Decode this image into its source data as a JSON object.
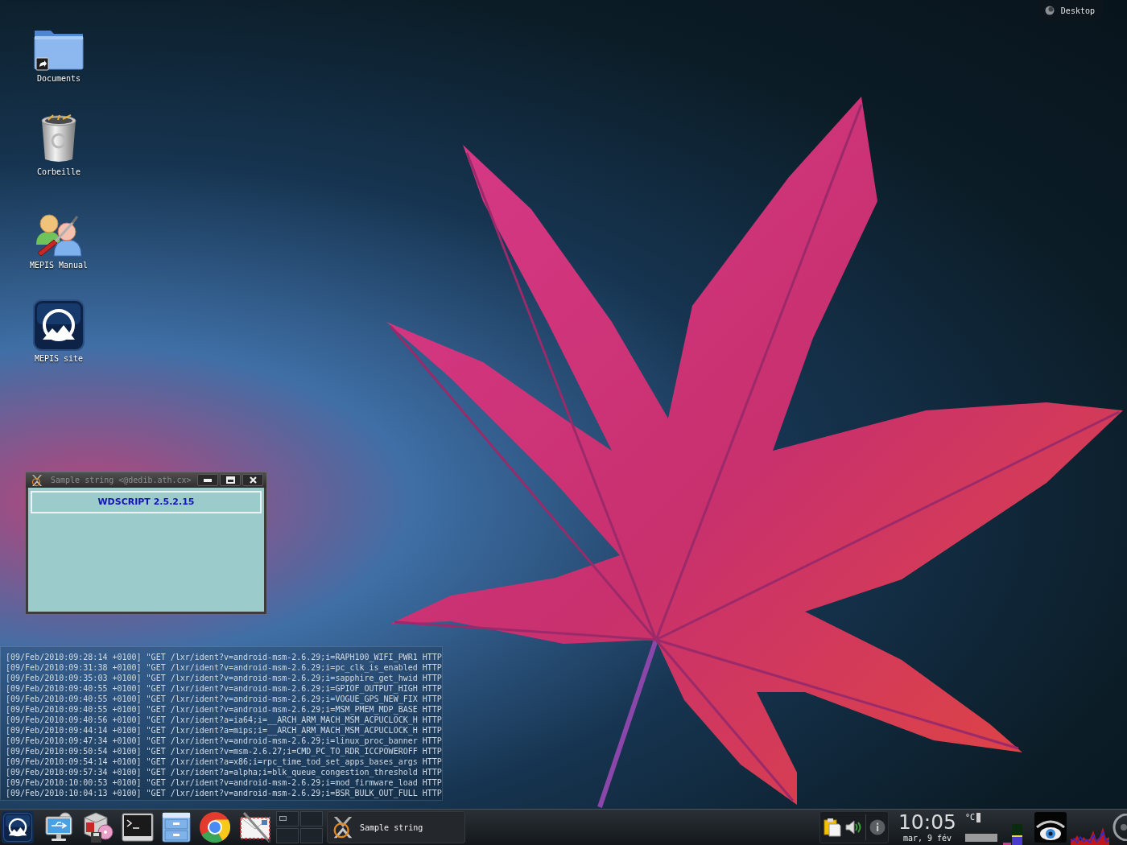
{
  "toolbox": {
    "label": "Desktop"
  },
  "desktop_icons": [
    {
      "label": "Documents"
    },
    {
      "label": "Corbeille"
    },
    {
      "label": "MEPIS Manual"
    },
    {
      "label": "MEPIS site"
    }
  ],
  "window": {
    "title": "Sample string <@dedib.ath.cx>",
    "heading": "WDSCRIPT 2.5.2.15"
  },
  "log_lines": [
    "[09/Feb/2010:09:28:14 +0100] \"GET /lxr/ident?v=android-msm-2.6.29;i=RAPH100_WIFI_PWR1 HTTP",
    "[09/Feb/2010:09:31:38 +0100] \"GET /lxr/ident?v=android-msm-2.6.29;i=pc_clk_is_enabled HTTP",
    "[09/Feb/2010:09:35:03 +0100] \"GET /lxr/ident?v=android-msm-2.6.29;i=sapphire_get_hwid HTTP",
    "[09/Feb/2010:09:40:55 +0100] \"GET /lxr/ident?v=android-msm-2.6.29;i=GPIOF_OUTPUT_HIGH HTTP",
    "[09/Feb/2010:09:40:55 +0100] \"GET /lxr/ident?v=android-msm-2.6.29;i=VOGUE_GPS_NEW_FIX HTTP",
    "[09/Feb/2010:09:40:55 +0100] \"GET /lxr/ident?v=android-msm-2.6.29;i=MSM_PMEM_MDP_BASE HTTP",
    "[09/Feb/2010:09:40:56 +0100] \"GET /lxr/ident?a=ia64;i=__ARCH_ARM_MACH_MSM_ACPUCLOCK_H HTTP",
    "[09/Feb/2010:09:44:14 +0100] \"GET /lxr/ident?a=mips;i=__ARCH_ARM_MACH_MSM_ACPUCLOCK_H HTTP",
    "[09/Feb/2010:09:47:34 +0100] \"GET /lxr/ident?v=android-msm-2.6.29;i=linux_proc_banner HTTP",
    "[09/Feb/2010:09:50:54 +0100] \"GET /lxr/ident?v=msm-2.6.27;i=CMD_PC_TO_RDR_ICCPOWEROFF HTTP",
    "[09/Feb/2010:09:54:14 +0100] \"GET /lxr/ident?a=x86;i=rpc_time_tod_set_apps_bases_args HTTP",
    "[09/Feb/2010:09:57:34 +0100] \"GET /lxr/ident?a=alpha;i=blk_queue_congestion_threshold HTTP",
    "[09/Feb/2010:10:00:53 +0100] \"GET /lxr/ident?v=android-msm-2.6.29;i=mod_firmware_load HTTP",
    "[09/Feb/2010:10:04:13 +0100] \"GET /lxr/ident?v=android-msm-2.6.29;i=BSR_BULK_OUT_FULL HTTP"
  ],
  "taskbar": {
    "task": {
      "label": "Sample string"
    },
    "clock": {
      "time": "10:05",
      "date": "mar, 9 fév"
    },
    "weather": {
      "unit": "°C"
    }
  }
}
